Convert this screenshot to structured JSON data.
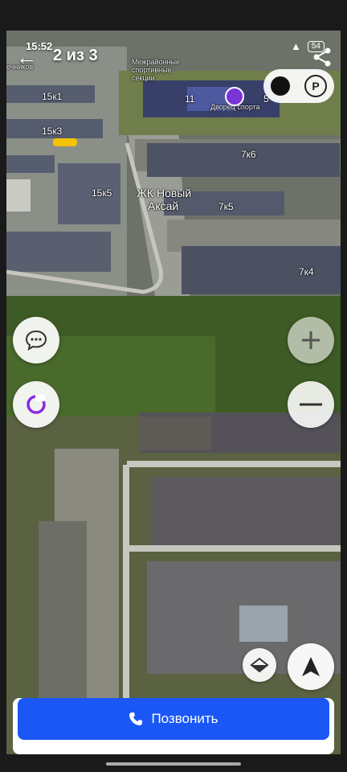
{
  "status": {
    "time": "15:52",
    "battery": "54"
  },
  "header": {
    "counter": "2 из 3"
  },
  "map": {
    "street_partial": "ечников",
    "complex_label_line1": "ЖК Новый",
    "complex_label_line2": "Аксай",
    "sport_label": "Дворец спорта",
    "sport_number": "11",
    "school_label_partial": "Межрайонные",
    "school_label_partial2": "спортивные",
    "school_label_partial3": "секции",
    "building_labels": [
      "15к1",
      "15к3",
      "15к5",
      "7к6",
      "7к5",
      "7к4",
      "5"
    ]
  },
  "controls": {
    "parking_label": "P"
  },
  "call": {
    "label": "Позвонить"
  },
  "colors": {
    "accent": "#1a57f5",
    "alice": "#8a2be2"
  },
  "icons": [
    "back-arrow-icon",
    "share-icon",
    "parking-icon",
    "chat-icon",
    "alice-icon",
    "zoom-in-icon",
    "zoom-out-icon",
    "tilt-icon",
    "compass-icon",
    "phone-icon"
  ]
}
